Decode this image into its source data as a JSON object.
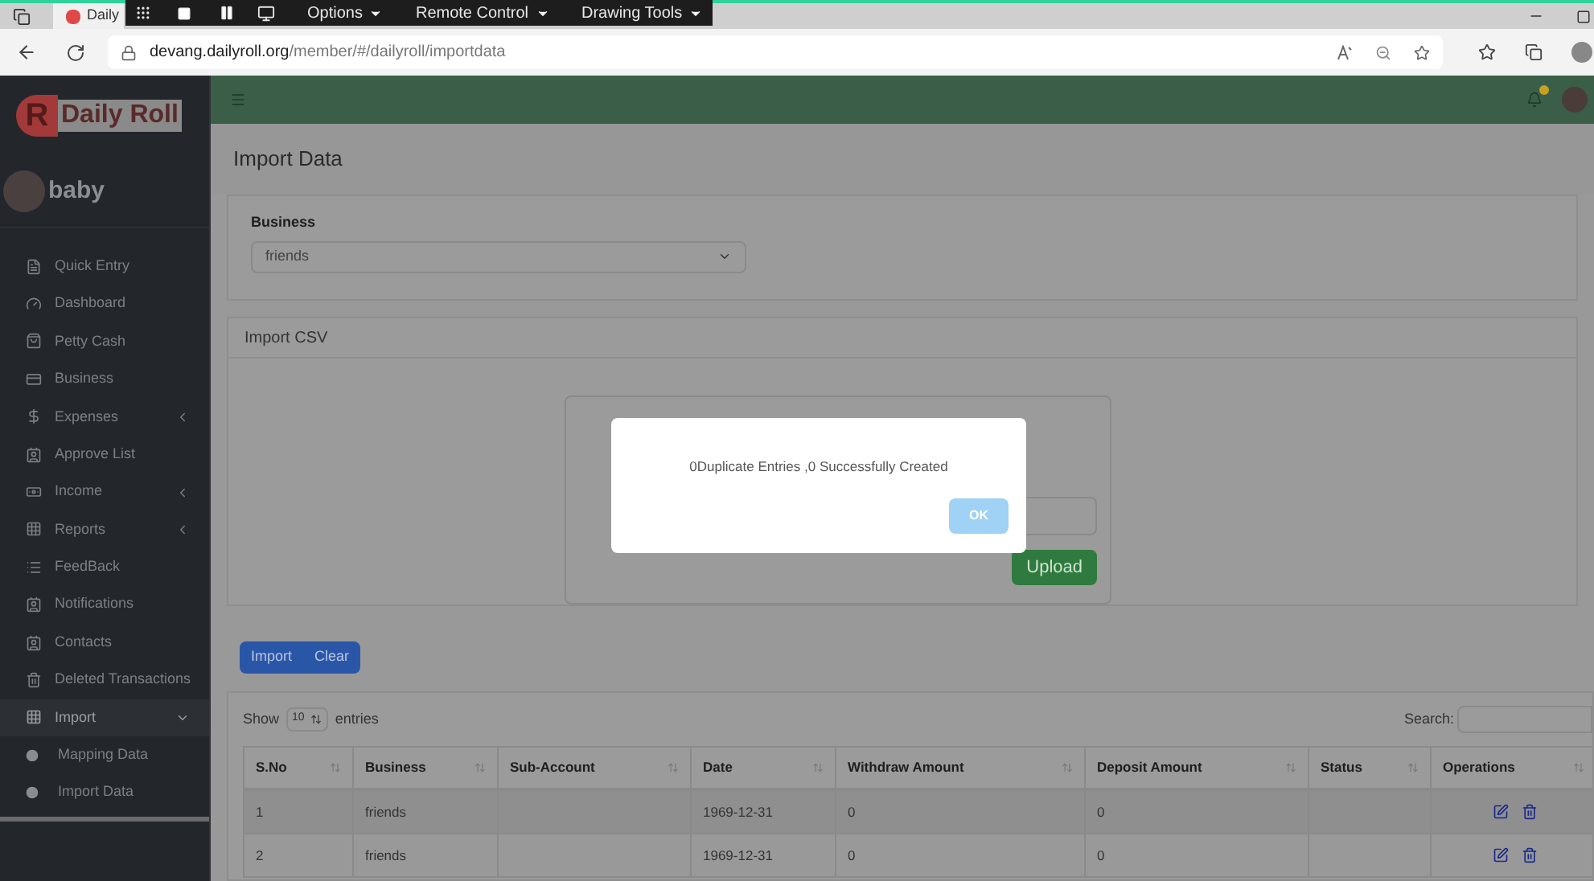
{
  "browser": {
    "tab_title": "Daily",
    "url_host": "devang.dailyroll.org",
    "url_path": "/member/#/dailyroll/importdata"
  },
  "remote_toolbar": {
    "menus": [
      "Options",
      "Remote Control",
      "Drawing Tools"
    ]
  },
  "sidebar": {
    "logo_letter": "R",
    "logo_text": "Daily Roll",
    "user": "baby",
    "items": [
      {
        "label": "Quick Entry",
        "selected": false
      },
      {
        "label": "Dashboard",
        "selected": false
      },
      {
        "label": "Petty Cash",
        "selected": false
      },
      {
        "label": "Business",
        "selected": false
      },
      {
        "label": "Expenses",
        "selected": false,
        "expanded": false
      },
      {
        "label": "Approve List",
        "selected": false
      },
      {
        "label": "Income",
        "selected": false,
        "expanded": false
      },
      {
        "label": "Reports",
        "selected": false,
        "expanded": false
      },
      {
        "label": "FeedBack",
        "selected": false
      },
      {
        "label": "Notifications",
        "selected": false
      },
      {
        "label": "Contacts",
        "selected": false
      },
      {
        "label": "Deleted Transactions",
        "selected": false
      },
      {
        "label": "Import",
        "selected": true,
        "expanded": true,
        "children": [
          {
            "label": "Mapping Data",
            "selected": false
          },
          {
            "label": "Import Data",
            "selected": false
          }
        ]
      }
    ]
  },
  "page_title": "Import Data",
  "business": {
    "label": "Business",
    "value": "friends"
  },
  "import_csv": {
    "title": "Import CSV",
    "button": "Upload"
  },
  "actions": [
    "Import",
    "Clear"
  ],
  "table": {
    "show_label": "Show",
    "page_size": "10",
    "entries_label": "entries",
    "search_label": "Search:",
    "columns": [
      "S.No",
      "Business",
      "Sub-Account",
      "Date",
      "Withdraw Amount",
      "Deposit Amount",
      "Status",
      "Operations"
    ],
    "rows": [
      {
        "sno": "1",
        "business": "friends",
        "sub_account": "",
        "date": "1969-12-31",
        "withdraw": "0",
        "deposit": "0",
        "status": ""
      },
      {
        "sno": "2",
        "business": "friends",
        "sub_account": "",
        "date": "1969-12-31",
        "withdraw": "0",
        "deposit": "0",
        "status": ""
      }
    ]
  },
  "dialog": {
    "message": "0Duplicate Entries ,0 Successfully Created",
    "button": "OK"
  }
}
